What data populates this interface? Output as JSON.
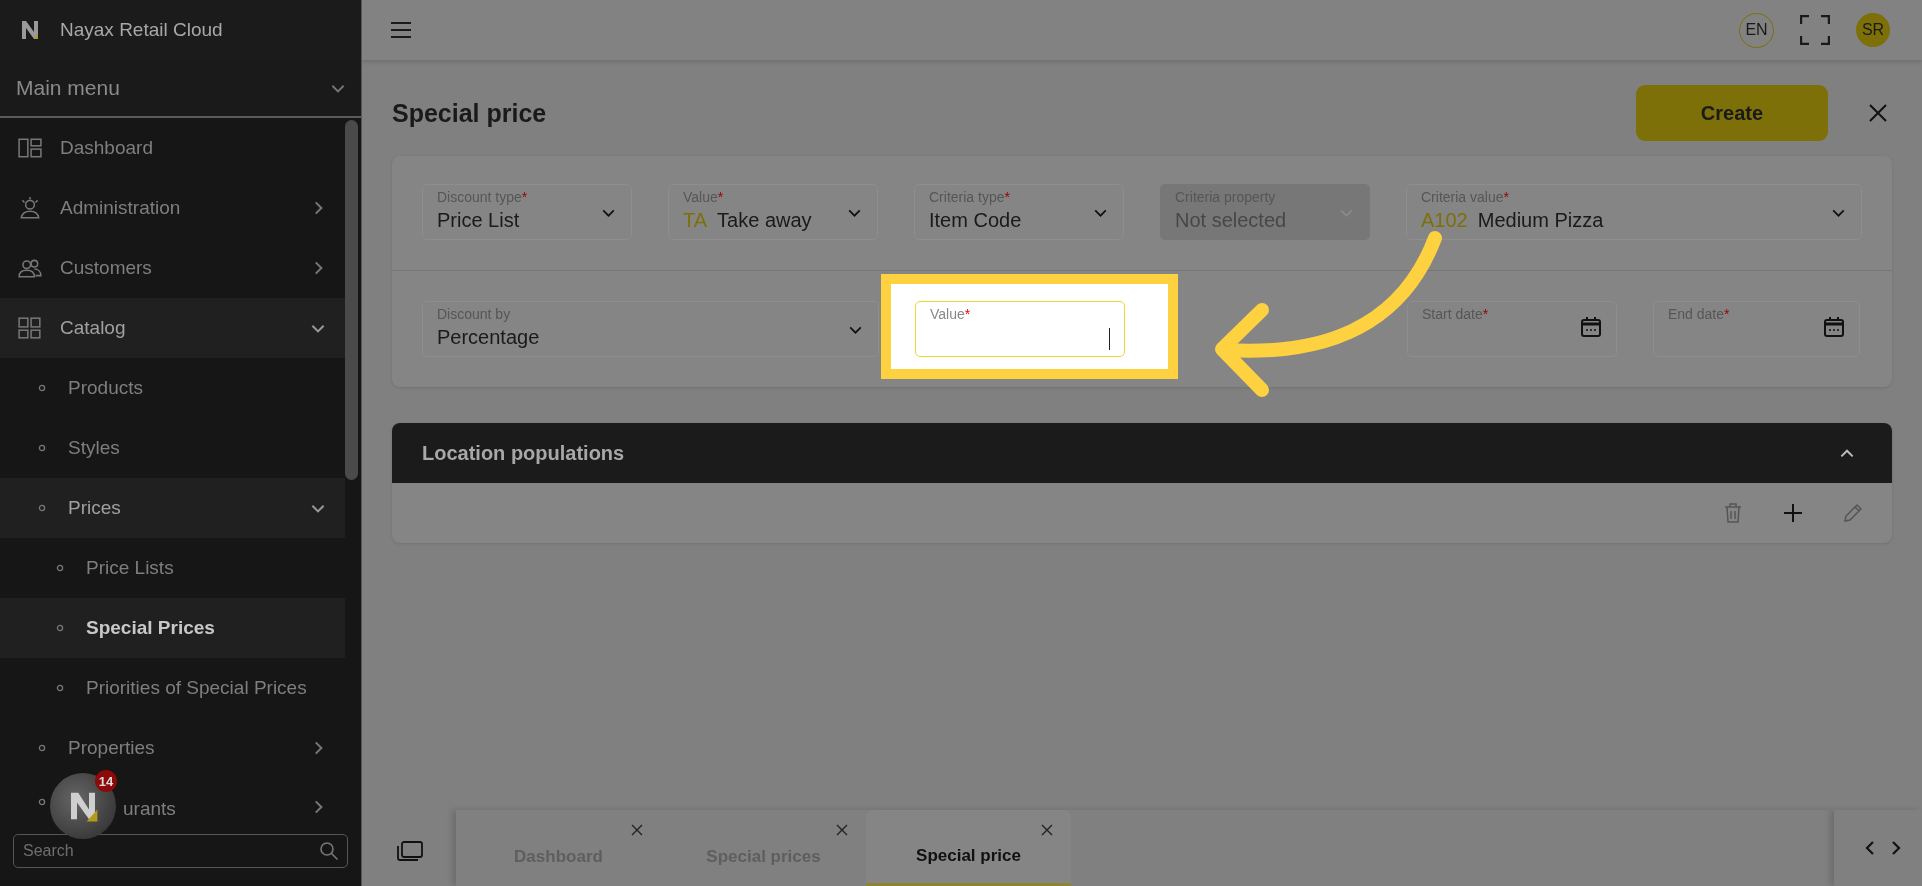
{
  "app": {
    "title": "Nayax Retail Cloud"
  },
  "sidebar": {
    "menu_title": "Main menu",
    "items": [
      {
        "label": "Dashboard",
        "selected": false
      },
      {
        "label": "Administration",
        "selected": false,
        "expanded": false
      },
      {
        "label": "Customers",
        "selected": false,
        "expanded": false
      },
      {
        "label": "Catalog",
        "selected": false,
        "expanded": true,
        "children": [
          {
            "label": "Products",
            "selected": false
          },
          {
            "label": "Styles",
            "selected": false
          },
          {
            "label": "Prices",
            "selected": false,
            "expanded": true,
            "children": [
              {
                "label": "Price Lists",
                "selected": false
              },
              {
                "label": "Special Prices",
                "selected": true
              },
              {
                "label": "Priorities of Special Prices",
                "selected": false
              }
            ]
          },
          {
            "label": "Properties",
            "selected": false,
            "expanded": false
          },
          {
            "label": "urants",
            "selected": false,
            "expanded": false
          }
        ]
      }
    ],
    "search": {
      "placeholder": "Search"
    },
    "widget": {
      "badge": "14"
    }
  },
  "topbar": {
    "language": "EN",
    "avatar": "SR"
  },
  "page": {
    "title": "Special price",
    "create_button": "Create"
  },
  "form": {
    "row_1": [
      {
        "kind": "select",
        "label": "Discount type",
        "required_mark": "*",
        "value": "Price List",
        "disabled": false
      },
      {
        "kind": "select",
        "label": "Value",
        "required_mark": "*",
        "code": "TA",
        "value": "Take away",
        "disabled": false
      },
      {
        "kind": "select",
        "label": "Criteria type",
        "required_mark": "*",
        "value": "Item Code",
        "disabled": false
      },
      {
        "kind": "select",
        "label": "Criteria property",
        "value": "Not selected",
        "disabled": true
      },
      {
        "kind": "select",
        "label": "Criteria value",
        "required_mark": "*",
        "code": "A102",
        "value": "Medium Pizza",
        "disabled": false
      }
    ],
    "row_2": [
      {
        "kind": "select",
        "label": "Discount by",
        "value": "Percentage",
        "disabled": false
      },
      {
        "kind": "input",
        "label": "Value",
        "required_mark": "*",
        "disabled": false,
        "highlighted": true
      },
      {
        "kind": "date",
        "label": "Start date",
        "required_mark": "*",
        "disabled": false
      },
      {
        "kind": "date",
        "label": "End date",
        "required_mark": "*",
        "disabled": false
      }
    ]
  },
  "location_populations": {
    "title": "Location populations",
    "expanded": true
  },
  "bottom_tabs": [
    {
      "label": "Dashboard",
      "selected": false
    },
    {
      "label": "Special prices",
      "selected": false
    },
    {
      "label": "Special price",
      "selected": true
    }
  ]
}
